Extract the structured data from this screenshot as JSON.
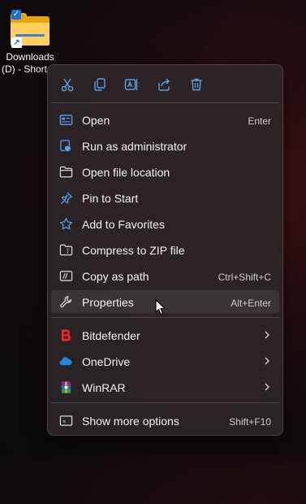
{
  "desktop": {
    "shortcut_label_line1": "Downloads",
    "shortcut_label_line2": "(D) - Short"
  },
  "toolbar": {
    "buttons": [
      {
        "name": "cut",
        "icon": "scissors-icon"
      },
      {
        "name": "copy",
        "icon": "copy-icon"
      },
      {
        "name": "rename",
        "icon": "rename-icon"
      },
      {
        "name": "share",
        "icon": "share-icon"
      },
      {
        "name": "delete",
        "icon": "trash-icon"
      }
    ],
    "accent": "#5aa0ea"
  },
  "menu": {
    "items": [
      {
        "label": "Open",
        "shortcut": "Enter",
        "icon": "open-icon"
      },
      {
        "label": "Run as administrator",
        "shortcut": "",
        "icon": "shield-icon"
      },
      {
        "label": "Open file location",
        "shortcut": "",
        "icon": "folder-icon"
      },
      {
        "label": "Pin to Start",
        "shortcut": "",
        "icon": "pin-icon"
      },
      {
        "label": "Add to Favorites",
        "shortcut": "",
        "icon": "star-icon"
      },
      {
        "label": "Compress to ZIP file",
        "shortcut": "",
        "icon": "zip-folder-icon"
      },
      {
        "label": "Copy as path",
        "shortcut": "Ctrl+Shift+C",
        "icon": "path-icon"
      },
      {
        "label": "Properties",
        "shortcut": "Alt+Enter",
        "icon": "wrench-icon",
        "hovered": true
      }
    ],
    "submenus": [
      {
        "label": "Bitdefender",
        "icon": "bitdefender-icon"
      },
      {
        "label": "OneDrive",
        "icon": "onedrive-icon"
      },
      {
        "label": "WinRAR",
        "icon": "winrar-icon"
      }
    ],
    "footer": {
      "label": "Show more options",
      "shortcut": "Shift+F10",
      "icon": "more-options-icon"
    }
  },
  "colors": {
    "menu_bg": "#2c2426",
    "hover_bg": "#3a3436",
    "icon_blue": "#5aa0ea",
    "bitdefender_red": "#e8242c",
    "onedrive_blue": "#1d8ae0"
  }
}
